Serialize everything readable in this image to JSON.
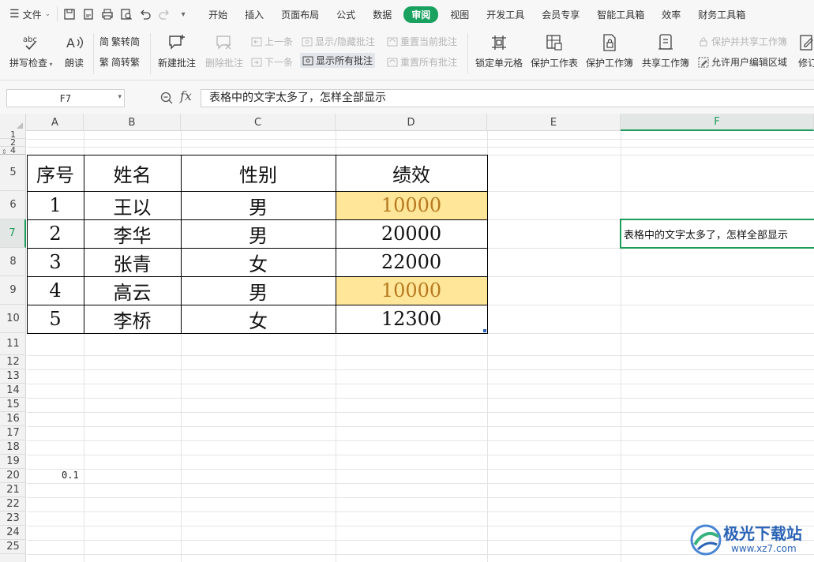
{
  "menubar": {
    "file_label": "文件",
    "tabs": [
      "开始",
      "插入",
      "页面布局",
      "公式",
      "数据",
      "审阅",
      "视图",
      "开发工具",
      "会员专享",
      "智能工具箱",
      "效率",
      "财务工具箱"
    ],
    "active_tab": "审阅"
  },
  "ribbon": {
    "spell_check": "拼写检查",
    "read_aloud": "朗读",
    "trad_to_simp": "繁转简",
    "simp_to_trad": "简转繁",
    "new_comment": "新建批注",
    "delete_comment": "删除批注",
    "prev": "上一条",
    "next": "下一条",
    "show_hide_comment": "显示/隐藏批注",
    "show_all_comments": "显示所有批注",
    "reset_current_comment": "重置当前批注",
    "reset_all_comments": "重置所有批注",
    "lock_cell": "锁定单元格",
    "protect_sheet": "保护工作表",
    "protect_workbook": "保护工作簿",
    "share_workbook": "共享工作簿",
    "protect_and_share": "保护并共享工作簿",
    "allow_edit_ranges": "允许用户编辑区域",
    "revise": "修订"
  },
  "formula_bar": {
    "name_box": "F7",
    "fx_label": "fx",
    "content": "表格中的文字太多了，怎样全部显示"
  },
  "columns": [
    "A",
    "B",
    "C",
    "D",
    "E",
    "F"
  ],
  "selected_column": "F",
  "rows": [
    "1",
    "2",
    "4",
    "5",
    "6",
    "7",
    "8",
    "9",
    "10",
    "11",
    "12",
    "13",
    "14",
    "15",
    "16",
    "17",
    "18",
    "19",
    "20",
    "21",
    "22",
    "23",
    "24",
    "25"
  ],
  "selected_row": "7",
  "table": {
    "headers": [
      "序号",
      "姓名",
      "性别",
      "绩效"
    ],
    "rows": [
      [
        "1",
        "王以",
        "男",
        "10000"
      ],
      [
        "2",
        "李华",
        "男",
        "20000"
      ],
      [
        "3",
        "张青",
        "女",
        "22000"
      ],
      [
        "4",
        "高云",
        "男",
        "10000"
      ],
      [
        "5",
        "李桥",
        "女",
        "12300"
      ]
    ],
    "highlight_color": "#ffe699"
  },
  "f7_value": "表格中的文字太多了，怎样全部显示",
  "a18_value": "0.1",
  "watermark": {
    "title": "极光下载站",
    "url": "www.xz7.com"
  },
  "accent_color": "#19a15f"
}
